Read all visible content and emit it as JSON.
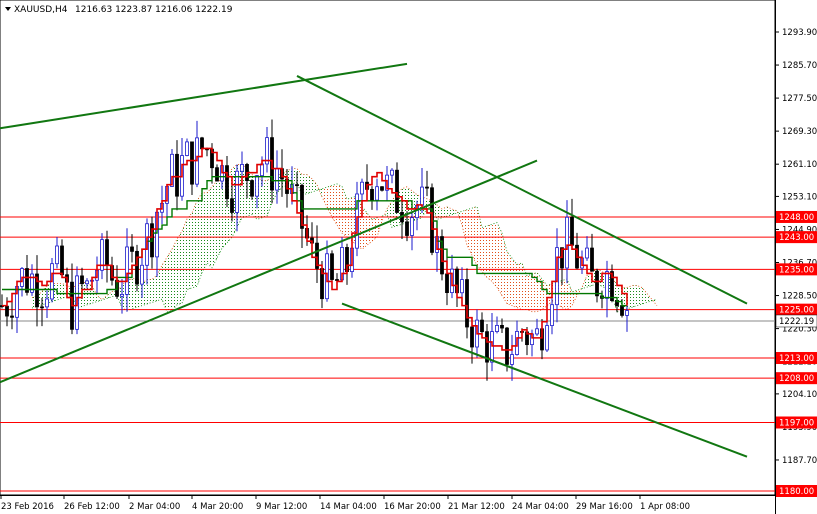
{
  "header": {
    "symbol": "XAUUSD,H4",
    "ohlc": "1216.63 1223.87 1216.06 1222.19"
  },
  "chart_data": {
    "type": "candlestick",
    "ylim": [
      1180,
      1300
    ],
    "x_tick_labels": [
      "23 Feb 2016",
      "26 Feb 12:00",
      "2 Mar 04:00",
      "4 Mar 20:00",
      "9 Mar 12:00",
      "14 Mar 04:00",
      "16 Mar 20:00",
      "21 Mar 12:00",
      "24 Mar 04:00",
      "29 Mar 16:00",
      "1 Apr 08:00"
    ],
    "y_tick_labels": [
      "1293.90",
      "1285.70",
      "1277.50",
      "1269.30",
      "1261.10",
      "1253.10",
      "1244.90",
      "1236.70",
      "1228.50",
      "1220.30",
      "1212.10",
      "1204.10",
      "1195.90",
      "1187.70"
    ],
    "current_price": {
      "value": 1222.19,
      "label": "1222.19"
    },
    "horizontal_levels": [
      {
        "value": 1248.0,
        "label": "1248.00"
      },
      {
        "value": 1243.0,
        "label": "1243.00"
      },
      {
        "value": 1235.0,
        "label": "1235.00"
      },
      {
        "value": 1225.0,
        "label": "1225.00"
      },
      {
        "value": 1213.0,
        "label": "1213.00"
      },
      {
        "value": 1208.0,
        "label": "1208.00"
      },
      {
        "value": 1197.0,
        "label": "1197.00"
      },
      {
        "value": 1180.0,
        "label": "1180.00"
      }
    ],
    "trendlines": [
      {
        "name": "upper-left-rising",
        "from": [
          0,
          1270.0
        ],
        "to": [
          67,
          1286.0
        ]
      },
      {
        "name": "descending-upper",
        "from": [
          53,
          1283.0
        ],
        "to": [
          135,
          1226.5
        ]
      },
      {
        "name": "ascending-support",
        "from": [
          0,
          1207.0
        ],
        "to": [
          93,
          1262.0
        ]
      },
      {
        "name": "descending-lower",
        "from": [
          62,
          1226.5
        ],
        "to": [
          135,
          1188.5
        ]
      }
    ],
    "tenkan": [
      1226,
      1227,
      1229,
      1232,
      1233,
      1233,
      1233,
      1232,
      1231,
      1232,
      1234,
      1234,
      1233,
      1228,
      1226,
      1228,
      1230,
      1230,
      1233,
      1236,
      1236,
      1236,
      1233,
      1232,
      1232,
      1234,
      1236,
      1238,
      1240,
      1243,
      1245,
      1250,
      1252,
      1256,
      1258,
      1258,
      1261,
      1262,
      1262,
      1263,
      1265,
      1265,
      1264,
      1262,
      1259,
      1258,
      1256,
      1256,
      1258,
      1259,
      1259,
      1261,
      1262,
      1262,
      1260,
      1260,
      1258,
      1255,
      1252,
      1249,
      1246,
      1242,
      1238,
      1236,
      1234,
      1232,
      1230,
      1232,
      1234,
      1236,
      1244,
      1248,
      1252,
      1256,
      1258,
      1259,
      1257,
      1255,
      1254,
      1253,
      1252,
      1250,
      1250,
      1251,
      1250,
      1249,
      1245,
      1240,
      1237,
      1234,
      1231,
      1228,
      1226,
      1223,
      1221,
      1219,
      1218,
      1217,
      1216,
      1216,
      1215,
      1215,
      1216,
      1218,
      1220,
      1219,
      1218,
      1218,
      1222,
      1228,
      1232,
      1238,
      1240,
      1241,
      1240,
      1238,
      1236,
      1234,
      1232,
      1232,
      1234,
      1234,
      1233,
      1231,
      1229,
      1226
    ],
    "kijun": [
      1230,
      1230,
      1230,
      1230,
      1230,
      1230,
      1230,
      1230,
      1230,
      1230,
      1230,
      1229,
      1229,
      1229,
      1229,
      1229,
      1229,
      1229,
      1229,
      1229,
      1229,
      1230,
      1230,
      1233,
      1233,
      1233,
      1236,
      1238,
      1240,
      1242,
      1244,
      1245,
      1246,
      1248,
      1250,
      1250,
      1250,
      1252,
      1252,
      1252,
      1255,
      1257,
      1258,
      1258,
      1258,
      1258,
      1258,
      1258,
      1258,
      1258,
      1258,
      1258,
      1258,
      1258,
      1257,
      1257,
      1257,
      1257,
      1254,
      1252,
      1250,
      1250,
      1250,
      1250,
      1250,
      1250,
      1250,
      1250,
      1250,
      1250,
      1250,
      1252,
      1252,
      1252,
      1252,
      1252,
      1252,
      1252,
      1252,
      1252,
      1252,
      1252,
      1250,
      1250,
      1250,
      1250,
      1247,
      1242,
      1240,
      1238,
      1238,
      1238,
      1238,
      1238,
      1236,
      1234,
      1234,
      1234,
      1234,
      1234,
      1234,
      1234,
      1234,
      1234,
      1234,
      1234,
      1233,
      1232,
      1230,
      1229,
      1229,
      1229,
      1229,
      1229,
      1229,
      1229,
      1229,
      1229,
      1229,
      1229,
      1228,
      1228,
      1228,
      1227,
      1226,
      1226
    ]
  },
  "price_axis_color": "#000000",
  "colors": {
    "bull_candle": "#1a1acc",
    "bear_candle": "#000000",
    "tenkan": "#e00000",
    "kijun": "#007700",
    "level_line": "#ff0000",
    "level_label_bg": "#ff0000",
    "trendline": "#117711",
    "cloud_bull": "#008800",
    "cloud_bear": "#dd4400"
  }
}
